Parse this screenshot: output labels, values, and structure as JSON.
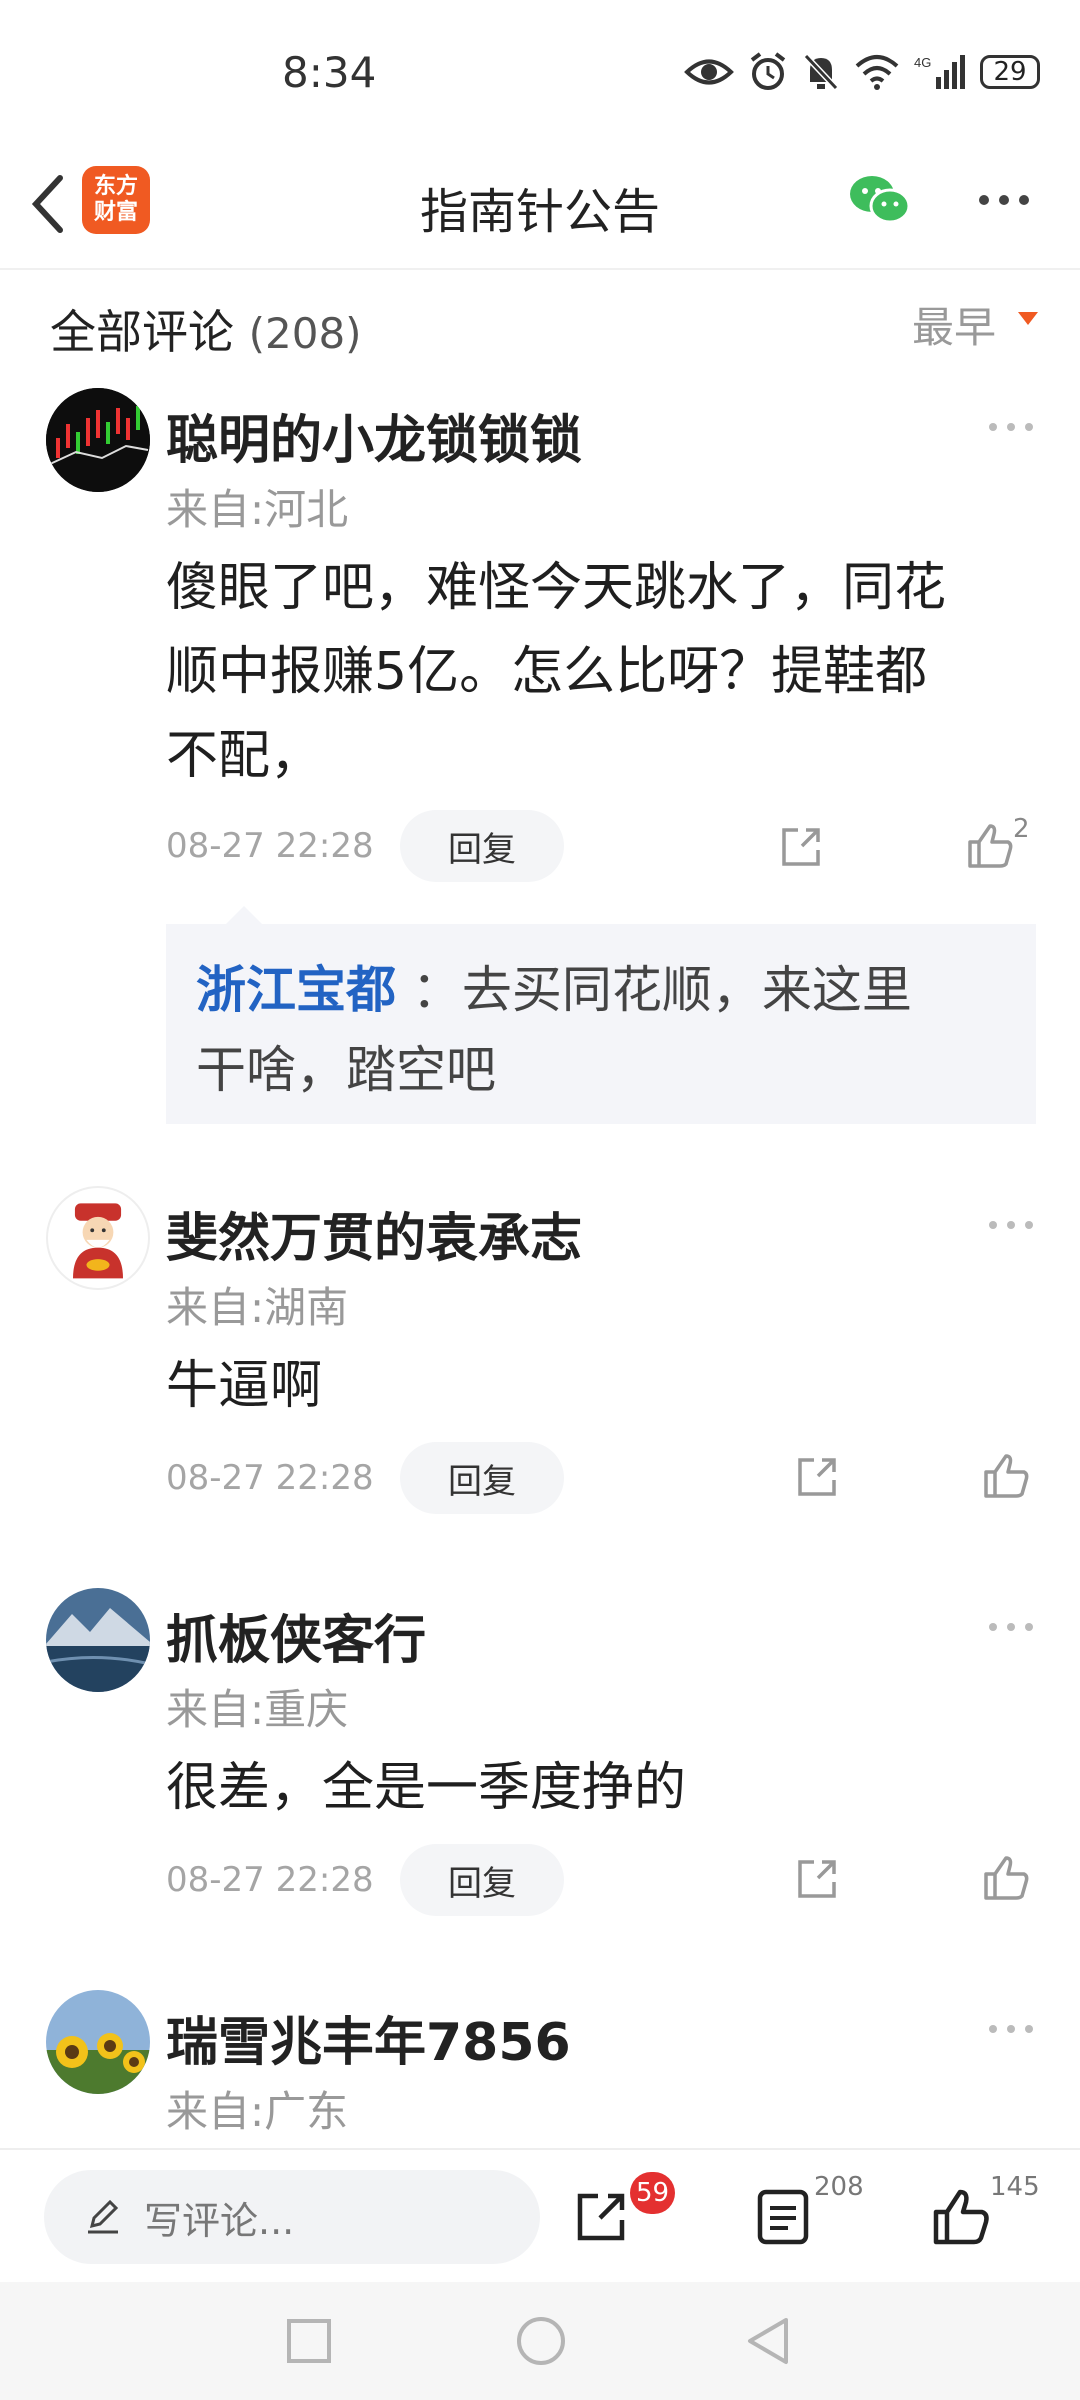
{
  "status": {
    "time": "8:34",
    "battery": "29",
    "network": "4G"
  },
  "header": {
    "title": "指南针公告",
    "logo_line1": "东方",
    "logo_line2": "财富"
  },
  "section": {
    "title": "全部评论",
    "count": "(208)",
    "sort_label": "最早"
  },
  "comments": [
    {
      "username": "聪明的小龙锁锁锁",
      "location": "来自:河北",
      "content_lines": [
        "傻眼了吧，难怪今天跳水了，同花",
        "顺中报赚5亿。怎么比呀？提鞋都",
        "不配，"
      ],
      "time": "08-27 22:28",
      "reply_label": "回复",
      "like_count": "2",
      "subreply": {
        "author": "浙江宝都",
        "text_line1": "：去买同花顺，来这里",
        "text_line2": "干啥，踏空吧"
      }
    },
    {
      "username": "斐然万贯的袁承志",
      "location": "来自:湖南",
      "content_lines": [
        "牛逼啊"
      ],
      "time": "08-27 22:28",
      "reply_label": "回复",
      "like_count": ""
    },
    {
      "username": "抓板侠客行",
      "location": "来自:重庆",
      "content_lines": [
        "很差，全是一季度挣的"
      ],
      "time": "08-27 22:28",
      "reply_label": "回复",
      "like_count": ""
    },
    {
      "username": "瑞雪兆丰年7856",
      "location": "来自:广东"
    }
  ],
  "bottom_bar": {
    "placeholder": "写评论...",
    "share_badge": "59",
    "comment_count": "208",
    "like_count": "145"
  },
  "colors": {
    "accent": "#f05a22",
    "link_blue": "#2263c3",
    "badge_red": "#e43030",
    "wechat_green": "#3ebd5c"
  },
  "icons": [
    "back-arrow-icon",
    "eye-icon",
    "alarm-icon",
    "mute-bell-icon",
    "wifi-icon",
    "signal-icon",
    "battery-icon",
    "wechat-icon",
    "more-icon",
    "share-icon",
    "like-icon",
    "pencil-icon",
    "comments-icon"
  ]
}
